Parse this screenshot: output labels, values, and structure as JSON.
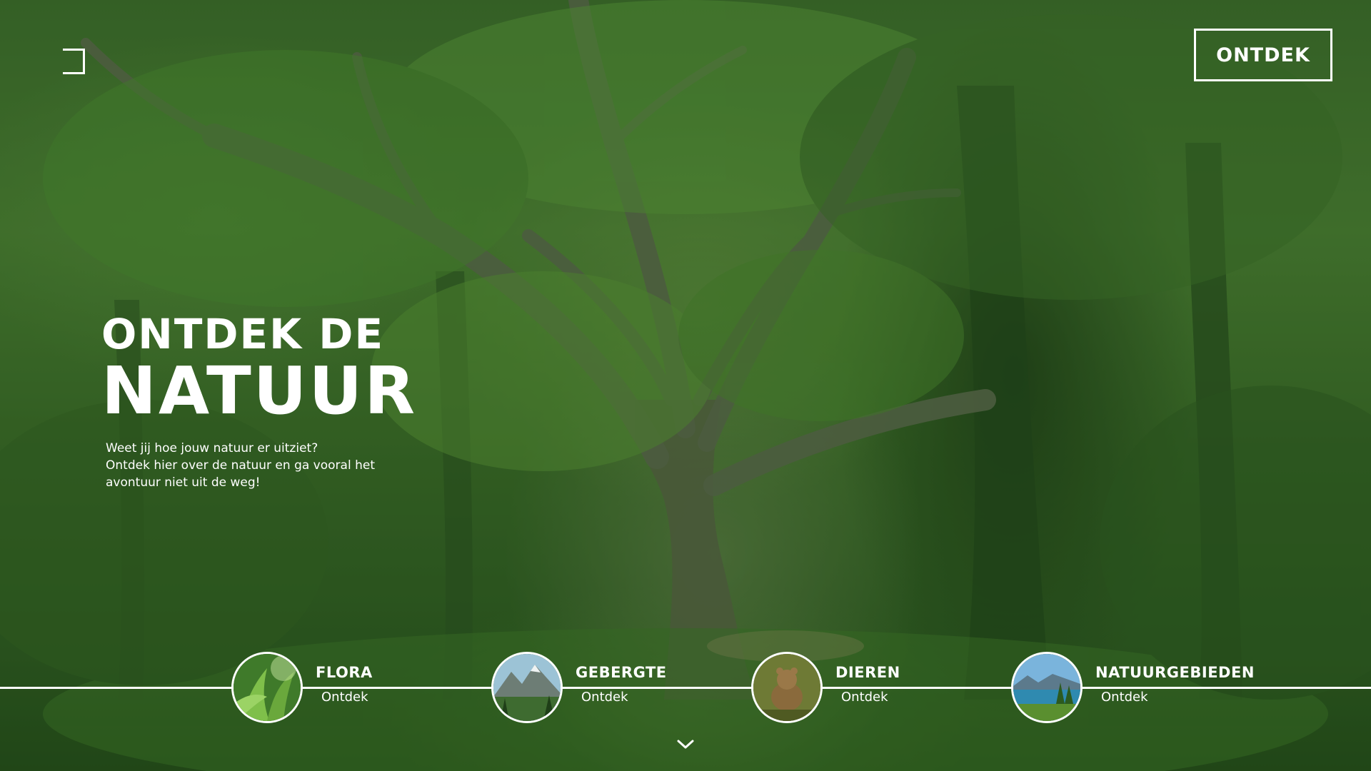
{
  "header": {
    "cta_label": "ONTDEK"
  },
  "hero": {
    "title_line1": "ONTDEK DE",
    "title_line2": "NATUUR",
    "body_lines": [
      "Weet jij hoe jouw natuur er uitziet?",
      "Ontdek hier over de natuur en ga vooral het",
      "avontuur niet uit de weg!"
    ]
  },
  "categories": [
    {
      "title": "FLORA",
      "link": "Ontdek",
      "icon": "plant-thumbnail"
    },
    {
      "title": "GEBERGTE",
      "link": "Ontdek",
      "icon": "mountain-thumbnail"
    },
    {
      "title": "DIEREN",
      "link": "Ontdek",
      "icon": "animal-thumbnail"
    },
    {
      "title": "NATUURGEBIEDEN",
      "link": "Ontdek",
      "icon": "lake-thumbnail"
    }
  ],
  "icons": {
    "menu": "menu-bracket-icon",
    "scroll": "chevron-down-icon"
  },
  "colors": {
    "forest_dark": "#244718",
    "forest_mid": "#4d7d33",
    "text": "#ffffff"
  }
}
